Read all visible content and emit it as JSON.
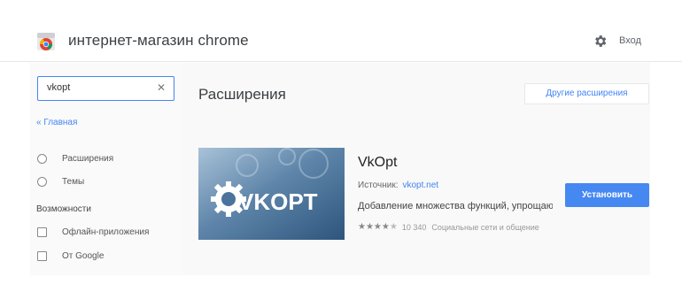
{
  "header": {
    "store_title": "интернет-магазин chrome",
    "signin_label": "Вход"
  },
  "sidebar": {
    "search": {
      "value": "vkopt",
      "placeholder": ""
    },
    "home_link": "« Главная",
    "categories": [
      {
        "label": "Расширения"
      },
      {
        "label": "Темы"
      }
    ],
    "features_heading": "Возможности",
    "features": [
      {
        "label": "Офлайн-приложения"
      },
      {
        "label": "От Google"
      }
    ]
  },
  "main": {
    "section_title": "Расширения",
    "more_button": "Другие расширения",
    "item": {
      "name": "VkOpt",
      "thumb_text": "VKOPT",
      "source_label": "Источник:",
      "source_link": "vkopt.net",
      "description": "Добавление множества функций, упрощающих работу с ВКонтакте",
      "rating_stars": 4.5,
      "rating_count": "10 340",
      "category": "Социальные сети и общение",
      "install_label": "Установить"
    }
  },
  "colors": {
    "accent": "#4285f4",
    "install_button": "#4688f1"
  }
}
